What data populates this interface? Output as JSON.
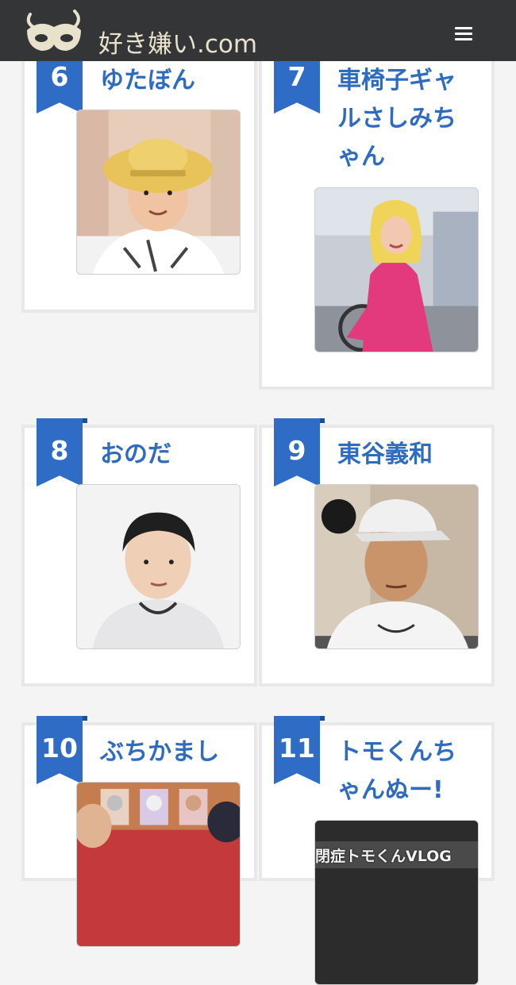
{
  "site": {
    "name": "好き嫌い.com",
    "menu_icon": "hamburger-icon"
  },
  "colors": {
    "header_bg": "#333537",
    "ribbon": "#2e6cc5",
    "name_link": "#2f6cc0",
    "card_border": "#e8e8e8"
  },
  "rankings": [
    {
      "rank": "6",
      "name": "ゆたぼん",
      "photo": "person-photo-straw-hat"
    },
    {
      "rank": "7",
      "name_lines": [
        "車椅子ギャ",
        "ルさしみち",
        "ゃん"
      ],
      "photo": "person-photo-pink-dress-wheelchair"
    },
    {
      "rank": "8",
      "name": "おのだ",
      "photo": "person-photo-white-background"
    },
    {
      "rank": "9",
      "name": "東谷義和",
      "photo": "person-photo-white-cap"
    },
    {
      "rank": "10",
      "name": "ぶちかまし",
      "photo": "group-photo-plush-dolls"
    },
    {
      "rank": "11",
      "name_lines": [
        "トモくんち",
        "ゃんぬー!"
      ],
      "photo": "video-thumbnail",
      "photo_caption": "閉症トモくんVLOG"
    }
  ]
}
